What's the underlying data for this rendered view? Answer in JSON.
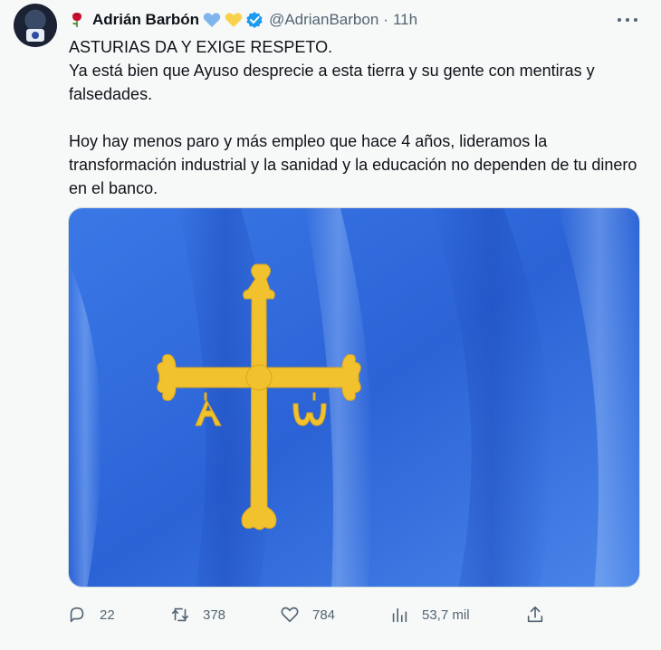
{
  "tweet": {
    "author": {
      "name": "Adrián Barbón",
      "handle": "@AdrianBarbon",
      "name_icons": [
        "rose-icon",
        "blue-heart-icon",
        "yellow-heart-icon",
        "verified-badge-icon"
      ]
    },
    "separator": "·",
    "time": "11h",
    "text": {
      "line1": "ASTURIAS DA Y EXIGE RESPETO.",
      "line2": "Ya está bien que Ayuso desprecie a esta tierra y su gente con mentiras y falsedades.",
      "line3": "Hoy hay menos paro y más empleo que hace 4 años, lideramos la transformación industrial y la sanidad y la educación no dependen de tu dinero en el banco."
    },
    "media": {
      "description_icon": "asturias-flag",
      "colors": {
        "field": "#2f6bdc",
        "cross": "#f2c12e"
      }
    },
    "actions": {
      "replies": "22",
      "retweets": "378",
      "likes": "784",
      "views": "53,7 mil"
    }
  },
  "colors": {
    "text_primary": "#0f1419",
    "text_secondary": "#536471",
    "verified": "#1d9bf0",
    "background": "#f7f9f9"
  }
}
